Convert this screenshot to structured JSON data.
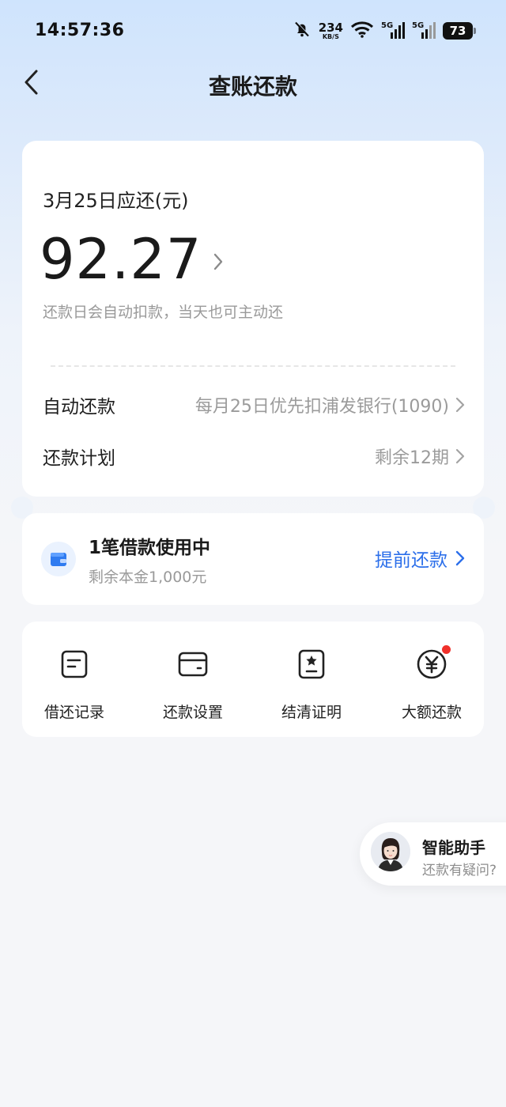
{
  "status_bar": {
    "time": "14:57:36",
    "net_speed_value": "234",
    "net_speed_unit": "KB/S",
    "signal1_tag": "5G",
    "signal2_tag": "5G",
    "battery": "73",
    "icons": [
      "bell-off-icon",
      "wifi-icon",
      "signal-icon",
      "signal-icon",
      "battery-icon"
    ]
  },
  "nav": {
    "title": "查账还款",
    "back_icon": "chevron-left-icon"
  },
  "bill": {
    "due_label": "3月25日应还(元)",
    "amount": "92.27",
    "hint": "还款日会自动扣款，当天也可主动还",
    "auto_repay_label": "自动还款",
    "auto_repay_value": "每月25日优先扣浦发银行(1090)",
    "plan_label": "还款计划",
    "plan_value": "剩余12期"
  },
  "loan": {
    "title": "1笔借款使用中",
    "subtitle": "剩余本金1,000元",
    "prepay_label": "提前还款",
    "accent_color": "#2c6fea"
  },
  "tools": [
    {
      "label": "借还记录",
      "icon": "record-icon"
    },
    {
      "label": "还款设置",
      "icon": "card-icon"
    },
    {
      "label": "结清证明",
      "icon": "certificate-icon"
    },
    {
      "label": "大额还款",
      "icon": "yuan-icon",
      "badge": true
    }
  ],
  "assistant": {
    "title": "智能助手",
    "subtitle": "还款有疑问?"
  }
}
